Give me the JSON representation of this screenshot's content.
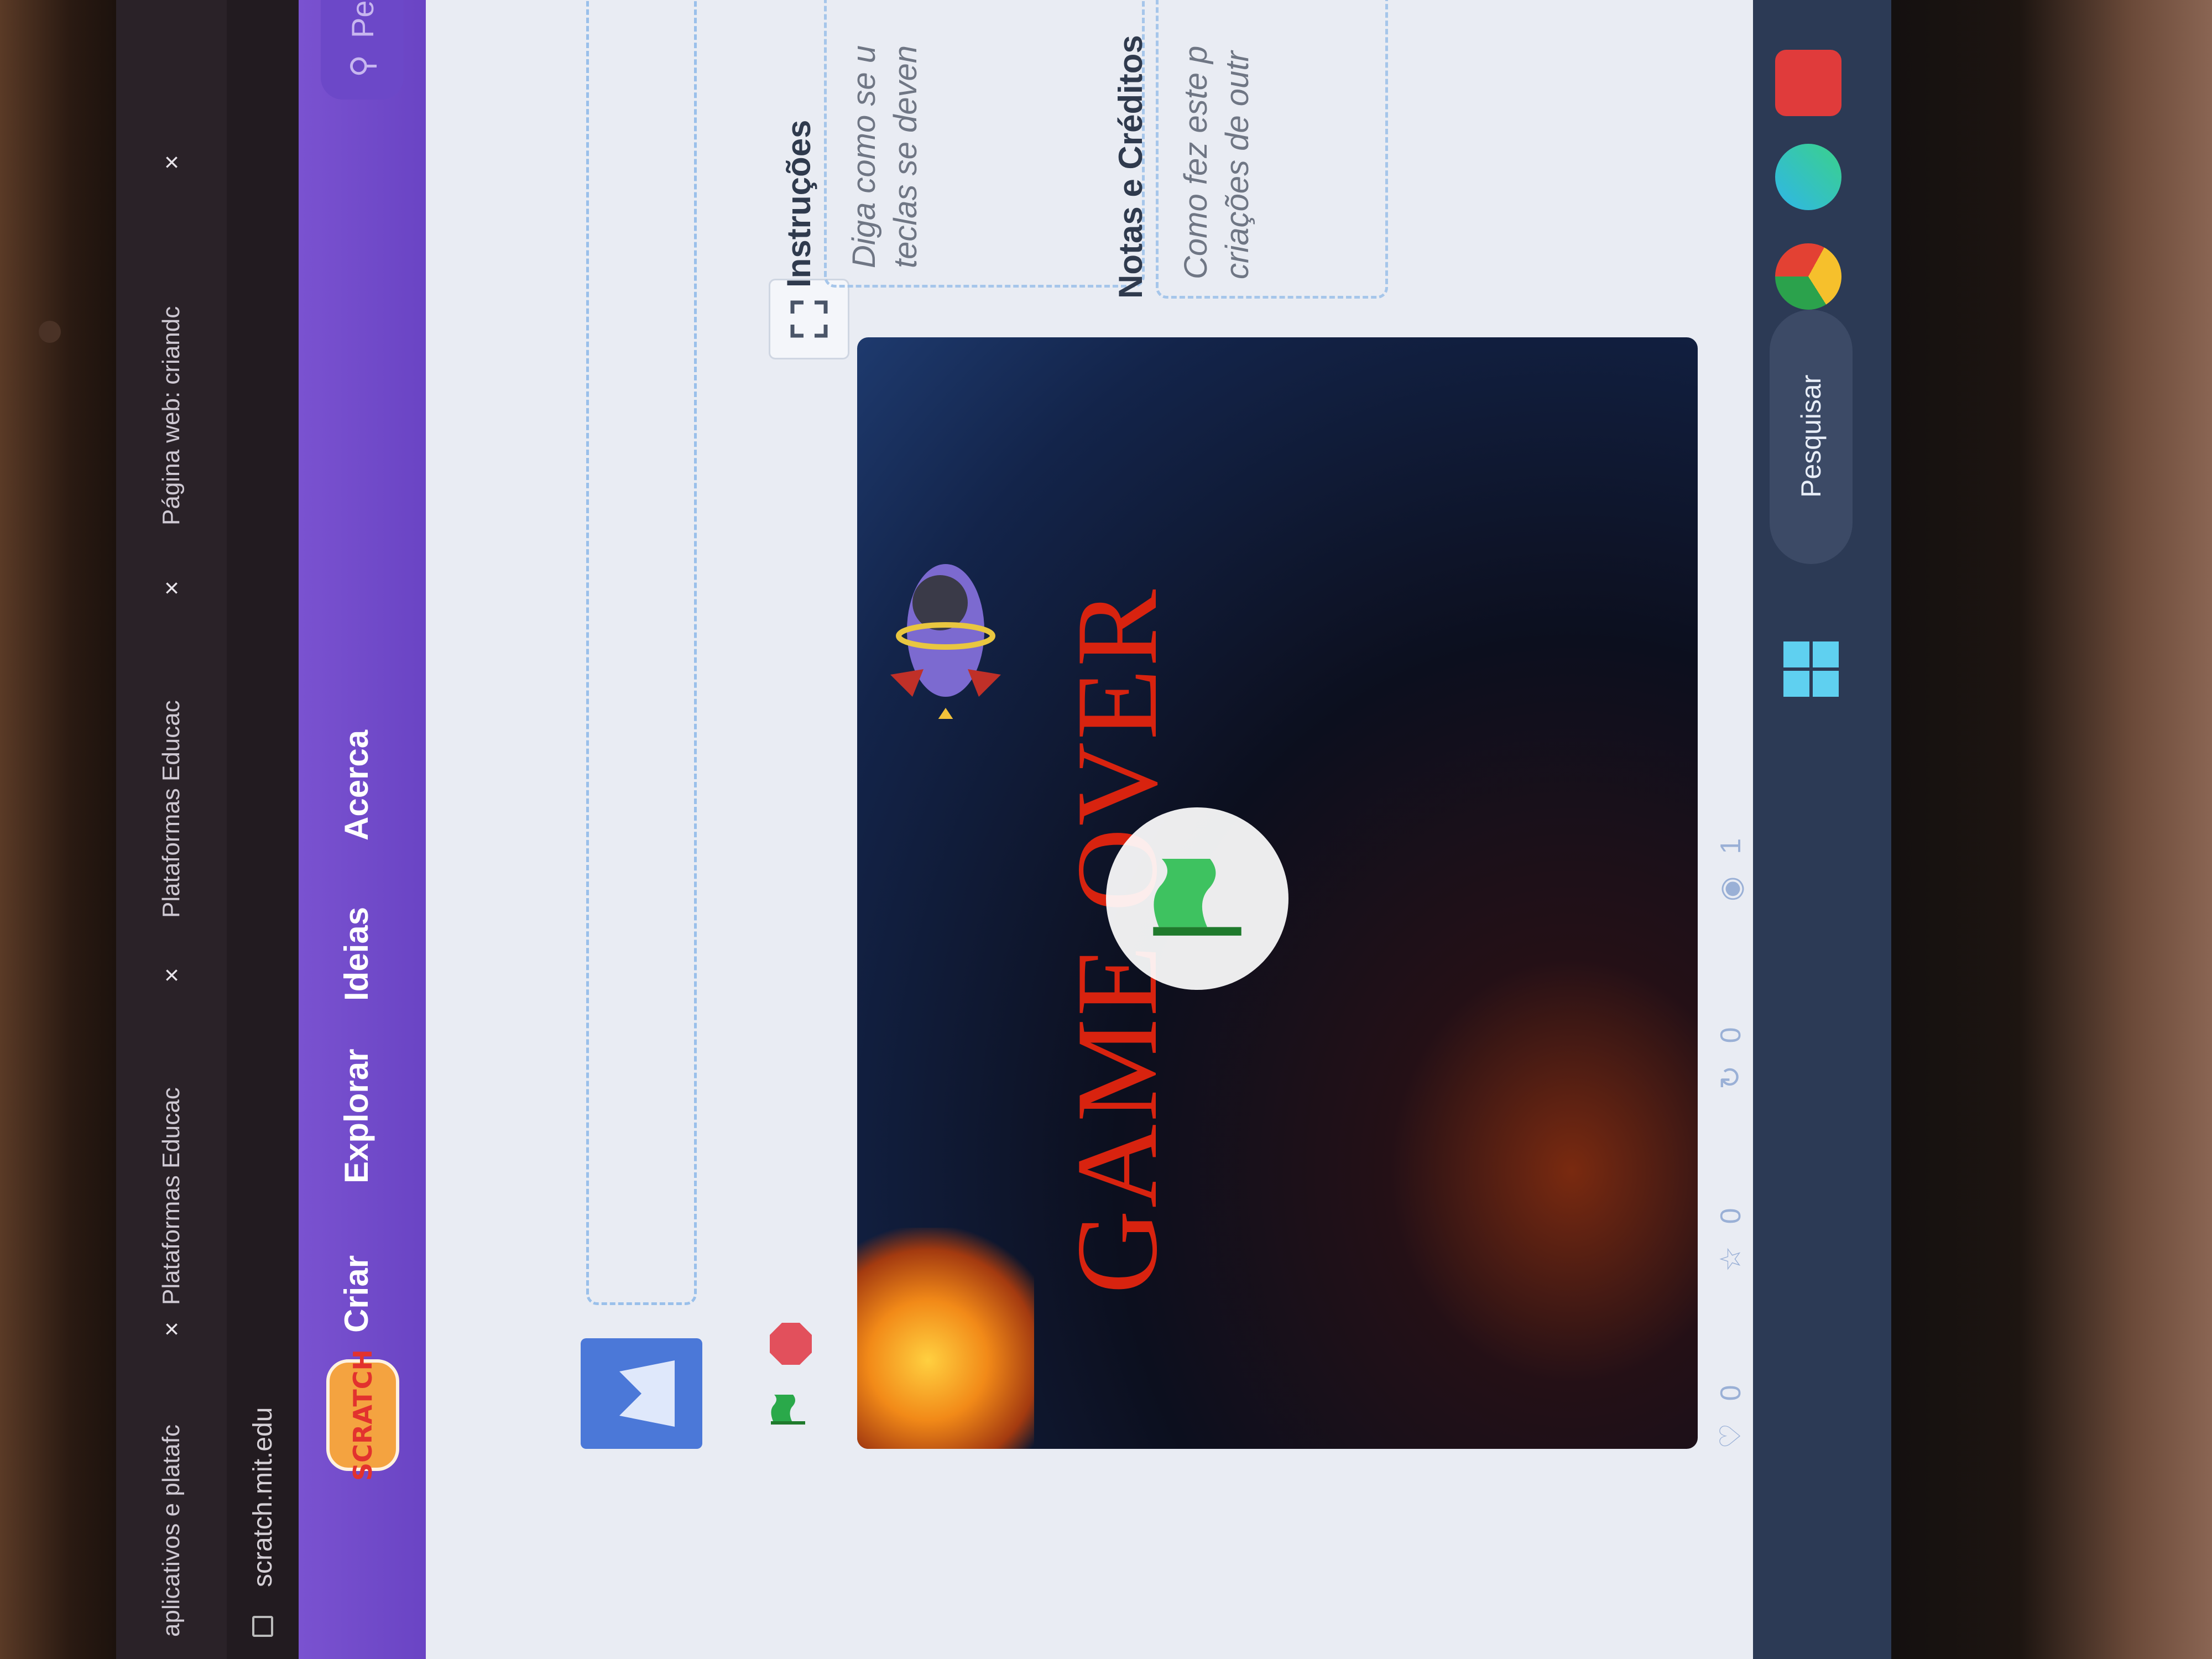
{
  "browser": {
    "tabs": [
      {
        "label": "aplicativos e platafc"
      },
      {
        "label": "Plataformas Educac"
      },
      {
        "label": "Plataformas Educac"
      },
      {
        "label": "Página web: criandc"
      }
    ],
    "address": "scratch.mit.edu"
  },
  "nav": {
    "logo": "SCRATCH",
    "links": [
      "Criar",
      "Explorar",
      "Ideias",
      "Acerca"
    ],
    "search_placeholder": "Pesquisa"
  },
  "stage": {
    "text": "GAME OVER"
  },
  "stats": {
    "loves": "0",
    "favorites": "0",
    "remixes": "0",
    "views": "1"
  },
  "side": {
    "instructions_heading": "Instruções",
    "instructions_text": "Diga como se u teclas se deven",
    "notes_heading": "Notas e Créditos",
    "notes_text": "Como fez este p criações de outr"
  },
  "taskbar": {
    "search_label": "Pesquisar"
  }
}
